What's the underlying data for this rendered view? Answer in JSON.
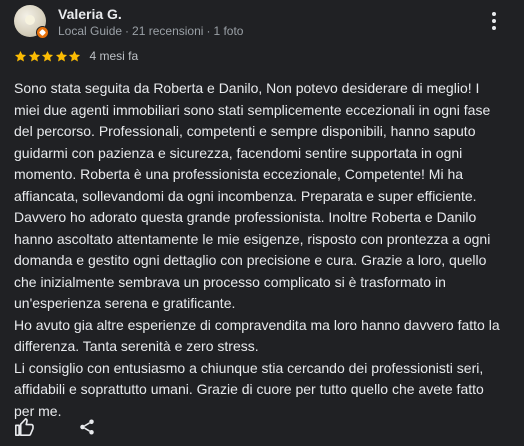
{
  "review": {
    "author": {
      "name": "Valeria G.",
      "badge": "Local Guide",
      "reviews_count": "21 recensioni",
      "photos_count": "1 foto"
    },
    "rating": 5,
    "max_rating": 5,
    "date": "4 mesi fa",
    "paragraphs": [
      "Sono stata seguita da Roberta e Danilo, Non potevo desiderare di meglio! I miei due agenti immobiliari sono stati semplicemente eccezionali in ogni fase del percorso. Professionali, competenti e sempre disponibili, hanno saputo guidarmi con pazienza e sicurezza, facendomi sentire supportata in ogni momento. Roberta è una professionista eccezionale, Competente! Mi ha affiancata, sollevandomi da ogni incombenza. Preparata e super efficiente. Davvero ho adorato questa grande professionista. Inoltre Roberta e Danilo hanno ascoltato attentamente le mie esigenze, risposto con prontezza a ogni domanda e gestito ogni dettaglio con precisione e cura. Grazie a loro, quello che inizialmente sembrava un processo complicato si è trasformato in un'esperienza serena e gratificante.",
      "Ho avuto gia altre esperienze di compravendita ma loro hanno davvero fatto la differenza. Tanta serenità e zero stress.",
      "Li consiglio con entusiasmo a chiunque stia cercando dei professionisti seri, affidabili e soprattutto umani. Grazie di cuore per tutto quello che avete fatto per me."
    ]
  },
  "colors": {
    "background": "#202124",
    "star": "#fbbc04",
    "text": "#e8eaed",
    "meta_text": "#9aa0a6",
    "local_guide_badge": "#e8710a"
  },
  "icons": {
    "menu": "more-vert-icon",
    "like": "thumb-up-icon",
    "share": "share-icon",
    "badge": "local-guide-badge-icon"
  },
  "separator": "·"
}
